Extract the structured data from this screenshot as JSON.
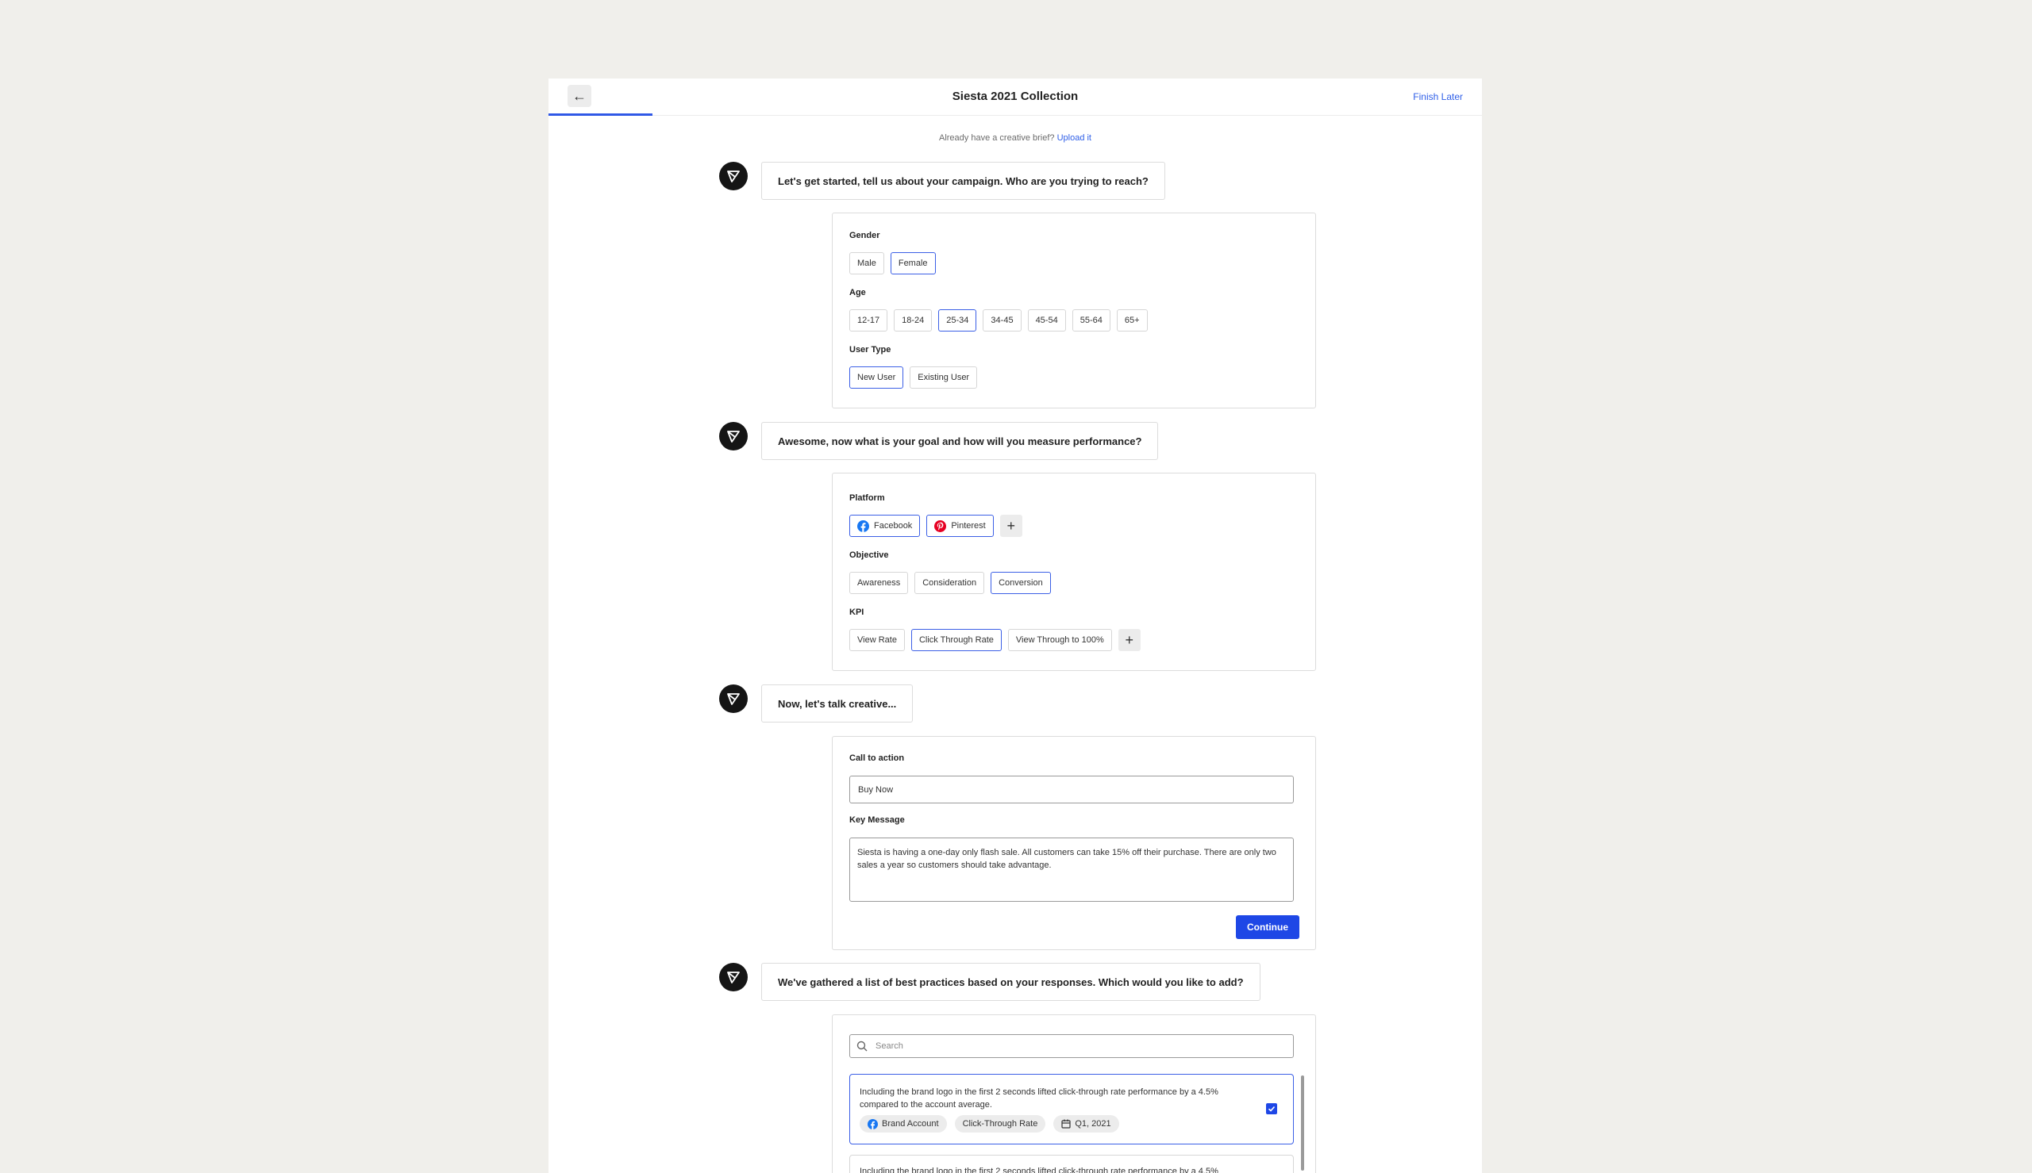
{
  "header": {
    "title": "Siesta 2021 Collection",
    "finish_later": "Finish Later"
  },
  "brief": {
    "text": "Already have a creative brief?",
    "link": "Upload it"
  },
  "step1": {
    "question": "Let's get started, tell us about your campaign. Who are you trying to reach?",
    "gender_label": "Gender",
    "gender": [
      "Male",
      "Female"
    ],
    "gender_selected": "Female",
    "age_label": "Age",
    "ages": [
      "12-17",
      "18-24",
      "25-34",
      "34-45",
      "45-54",
      "55-64",
      "65+"
    ],
    "age_selected": "25-34",
    "user_type_label": "User Type",
    "user_types": [
      "New User",
      "Existing User"
    ],
    "user_type_selected": "New User"
  },
  "step2": {
    "question": "Awesome, now what is your goal and how will you measure performance?",
    "platform_label": "Platform",
    "platforms": [
      "Facebook",
      "Pinterest"
    ],
    "objective_label": "Objective",
    "objectives": [
      "Awareness",
      "Consideration",
      "Conversion"
    ],
    "objective_selected": "Conversion",
    "kpi_label": "KPI",
    "kpis": [
      "View Rate",
      "Click Through Rate",
      "View Through to 100%"
    ],
    "kpi_selected": "Click Through Rate"
  },
  "step3": {
    "question": "Now, let's talk creative...",
    "cta_label": "Call to action",
    "cta_value": "Buy Now",
    "key_message_label": "Key Message",
    "key_message_value": "Siesta is having a one-day only flash sale. All customers can take 15% off their purchase. There are only two sales a year so customers should take advantage.",
    "continue_label": "Continue"
  },
  "step4": {
    "question": "We've gathered a list of best practices based on your responses. Which would you like to add?",
    "search_placeholder": "Search",
    "items": [
      {
        "text": "Including the brand logo in the first 2 seconds lifted click-through rate performance by a 4.5% compared to the account average.",
        "tags": [
          "Brand Account",
          "Click-Through Rate",
          "Q1, 2021"
        ],
        "checked": true
      },
      {
        "text": "Including the brand logo in the first 2 seconds lifted click-through rate performance by a 4.5%",
        "tags": [],
        "checked": false
      }
    ]
  },
  "colors": {
    "accent": "#3b5fe6",
    "primary_button": "#1e47e6",
    "background": "#f0efeb",
    "facebook": "#1877f2",
    "pinterest": "#e60023"
  }
}
